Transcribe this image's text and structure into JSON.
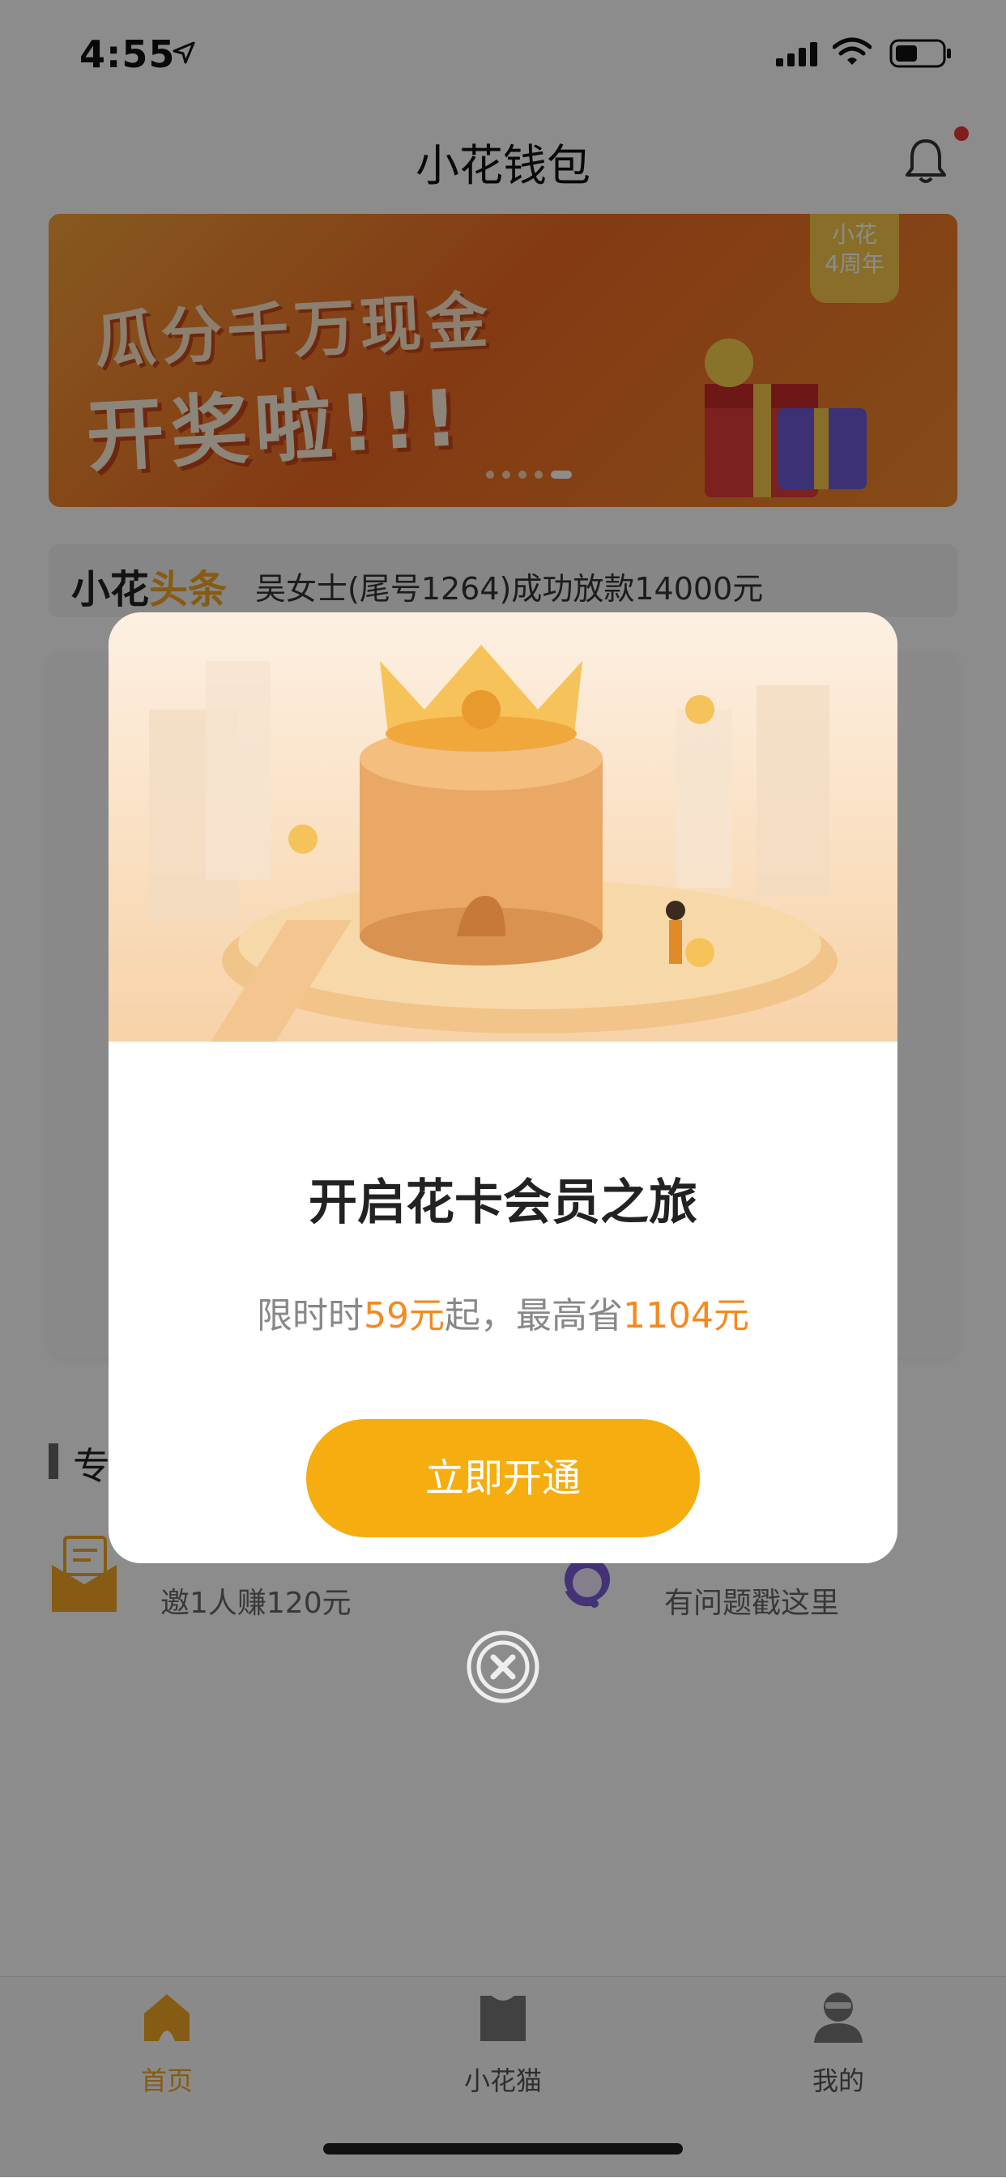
{
  "status_bar": {
    "time": "4:55"
  },
  "header": {
    "title": "小花钱包"
  },
  "banner": {
    "line1": "瓜分千万现金",
    "line2": "开奖啦!!!",
    "badge_line1": "小花",
    "badge_line2": "4周年"
  },
  "news": {
    "brand_part1": "小花",
    "brand_part2": "头条",
    "text": "吴女士(尾号1264)成功放款14000元"
  },
  "services": {
    "section_title": "专",
    "invite_label": "邀1人赚120元",
    "support_label": "有问题戳这里"
  },
  "modal": {
    "title": "开启花卡会员之旅",
    "desc_part1": "限时时",
    "desc_price": "59元",
    "desc_part2": "起，最高省",
    "desc_save": "1104元",
    "cta_label": "立即开通"
  },
  "tabbar": {
    "tabs": [
      {
        "label": "首页",
        "active": true
      },
      {
        "label": "小花猫",
        "active": false
      },
      {
        "label": "我的",
        "active": false
      }
    ]
  },
  "colors": {
    "accent": "#f5a623",
    "cta": "#f5ad10",
    "highlight": "#f5891f"
  },
  "icons": {
    "bell": "bell-icon",
    "close": "close-icon",
    "home": "home-icon",
    "bag": "bag-icon",
    "profile": "profile-icon"
  }
}
